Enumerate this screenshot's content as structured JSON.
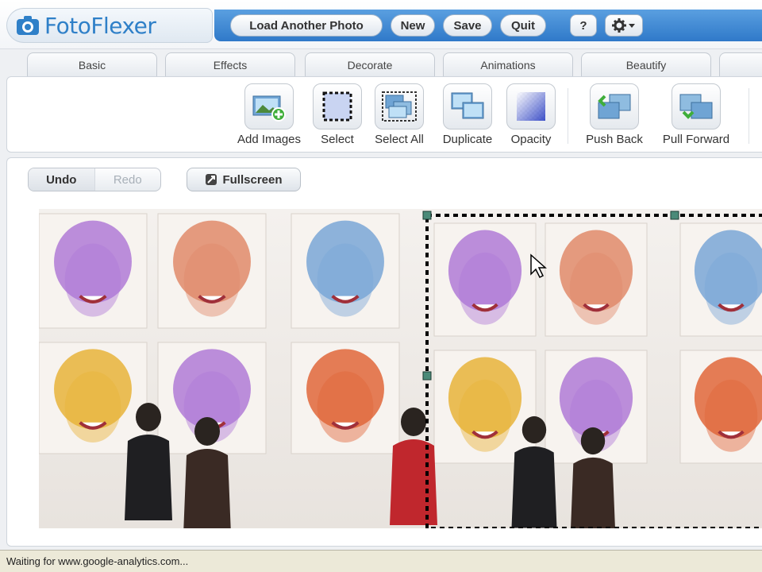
{
  "app": {
    "logo_text": "FotoFlexer"
  },
  "topbar": {
    "load_label": "Load Another Photo",
    "new_label": "New",
    "save_label": "Save",
    "quit_label": "Quit",
    "help_label": "?",
    "settings_icon": "gear-icon",
    "accent": "#3a87d4"
  },
  "tabs": [
    {
      "label": "Basic"
    },
    {
      "label": "Effects"
    },
    {
      "label": "Decorate"
    },
    {
      "label": "Animations"
    },
    {
      "label": "Beautify"
    }
  ],
  "toolbar": {
    "tools": [
      {
        "label": "Add Images",
        "icon": "add-images-icon"
      },
      {
        "label": "Select",
        "icon": "select-icon"
      },
      {
        "label": "Select All",
        "icon": "select-all-icon"
      },
      {
        "label": "Duplicate",
        "icon": "duplicate-icon"
      },
      {
        "label": "Opacity",
        "icon": "opacity-icon"
      },
      {
        "label": "Push Back",
        "icon": "push-back-icon"
      },
      {
        "label": "Pull Forward",
        "icon": "pull-forward-icon"
      }
    ]
  },
  "workarea": {
    "undo_label": "Undo",
    "redo_label": "Redo",
    "fullscreen_label": "Fullscreen",
    "selection_color": "#000000",
    "photo_tints": [
      "#b07ad6",
      "#e08a6a",
      "#7aa6d6",
      "#e8b33a",
      "#b07ad6",
      "#e0663a"
    ]
  },
  "status": {
    "text": "Waiting for www.google-analytics.com..."
  }
}
